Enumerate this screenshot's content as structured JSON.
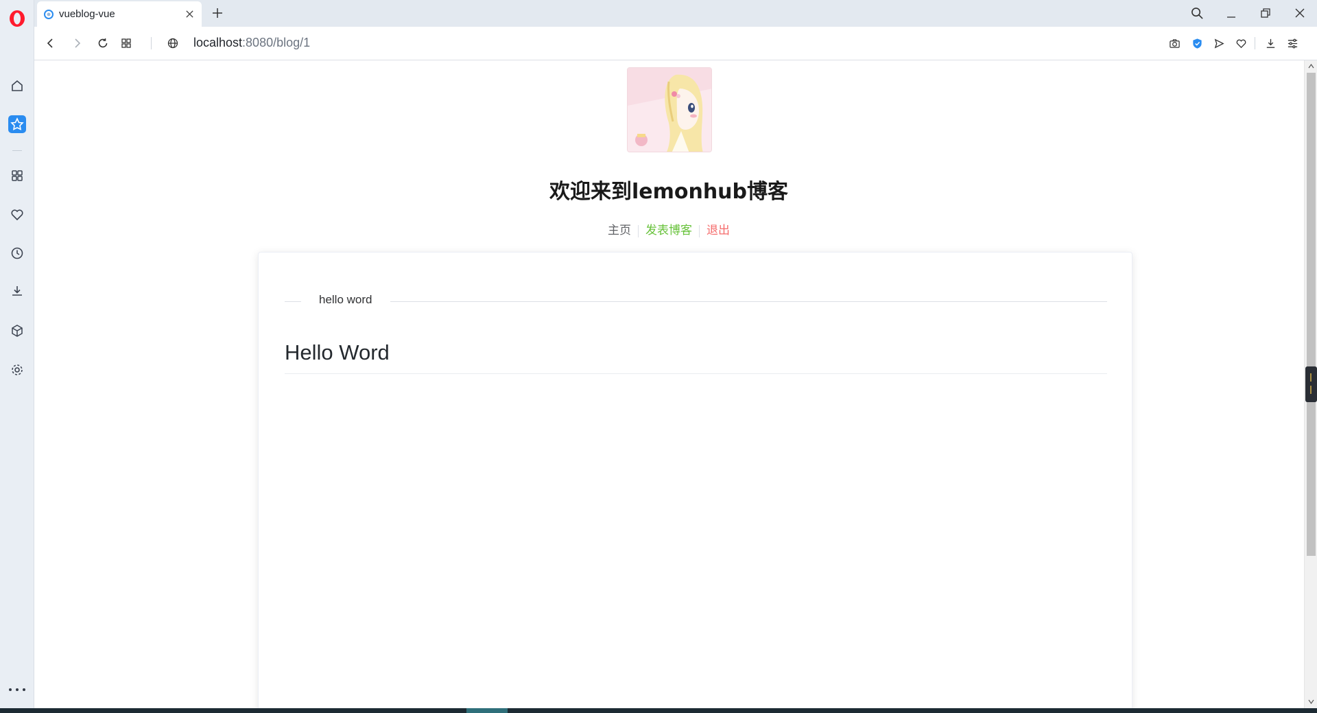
{
  "browser": {
    "tab": {
      "title": "vueblog-vue"
    },
    "address": {
      "host": "localhost",
      "path": ":8080/blog/1"
    },
    "brand_color": "#ff1b2d"
  },
  "sidebar": {
    "items": [
      {
        "name": "home",
        "icon": "home-icon"
      },
      {
        "name": "speed-dial",
        "icon": "star-icon",
        "active": true
      },
      {
        "name": "tabs",
        "icon": "grid-icon"
      },
      {
        "name": "bookmarks",
        "icon": "heart-icon"
      },
      {
        "name": "history",
        "icon": "clock-icon"
      },
      {
        "name": "downloads",
        "icon": "download-icon"
      },
      {
        "name": "extensions",
        "icon": "cube-icon"
      },
      {
        "name": "settings",
        "icon": "gear-icon"
      }
    ]
  },
  "page": {
    "site_title": "欢迎来到lemonhub博客",
    "nav": {
      "home": "主页",
      "post": "发表博客",
      "logout": "退出"
    },
    "blog": {
      "divider_text": "hello word",
      "heading": "Hello Word"
    }
  },
  "colors": {
    "link_success": "#67c23a",
    "link_danger": "#f56c6c",
    "active_sidebar": "#2a8cf0"
  }
}
